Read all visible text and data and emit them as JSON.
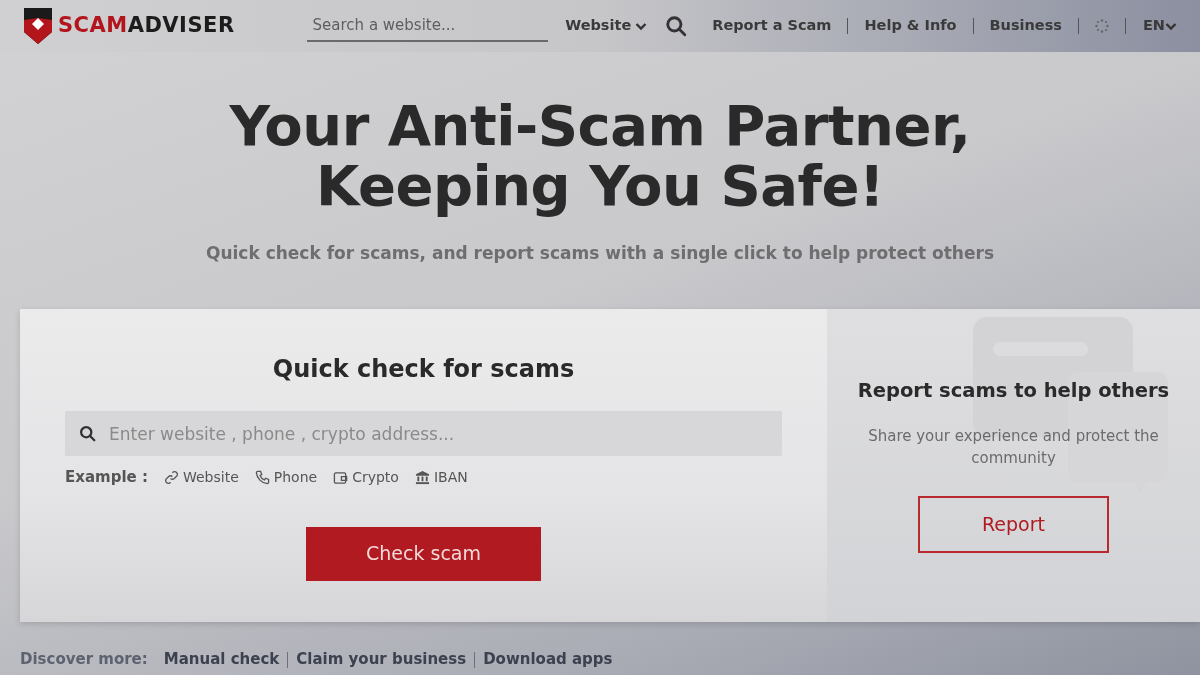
{
  "header": {
    "logo": {
      "red_part": "SCAM",
      "dark_part": "ADVISER"
    },
    "search": {
      "placeholder": "Search a website..."
    },
    "search_type": "Website",
    "nav_links": [
      "Report a Scam",
      "Help & Info",
      "Business"
    ],
    "language": "EN"
  },
  "hero": {
    "title_lines": [
      "Your Anti-Scam Partner,",
      "Keeping You Safe!"
    ],
    "subtitle": "Quick check for scams, and report scams with a single click to help protect others"
  },
  "quick_check": {
    "title": "Quick check for scams",
    "search": {
      "placeholder": "Enter website , phone , crypto address..."
    },
    "example_label": "Example :",
    "examples": [
      {
        "kind": "link",
        "label": "Website"
      },
      {
        "kind": "phone",
        "label": "Phone"
      },
      {
        "kind": "wallet",
        "label": "Crypto"
      },
      {
        "kind": "bank",
        "label": "IBAN"
      }
    ],
    "button": "Check scam"
  },
  "report": {
    "title": "Report scams to help others",
    "text": "Share your experience and protect the community",
    "button": "Report"
  },
  "discover": {
    "label": "Discover more:",
    "links": [
      "Manual check",
      "Claim your business",
      "Download apps"
    ]
  }
}
